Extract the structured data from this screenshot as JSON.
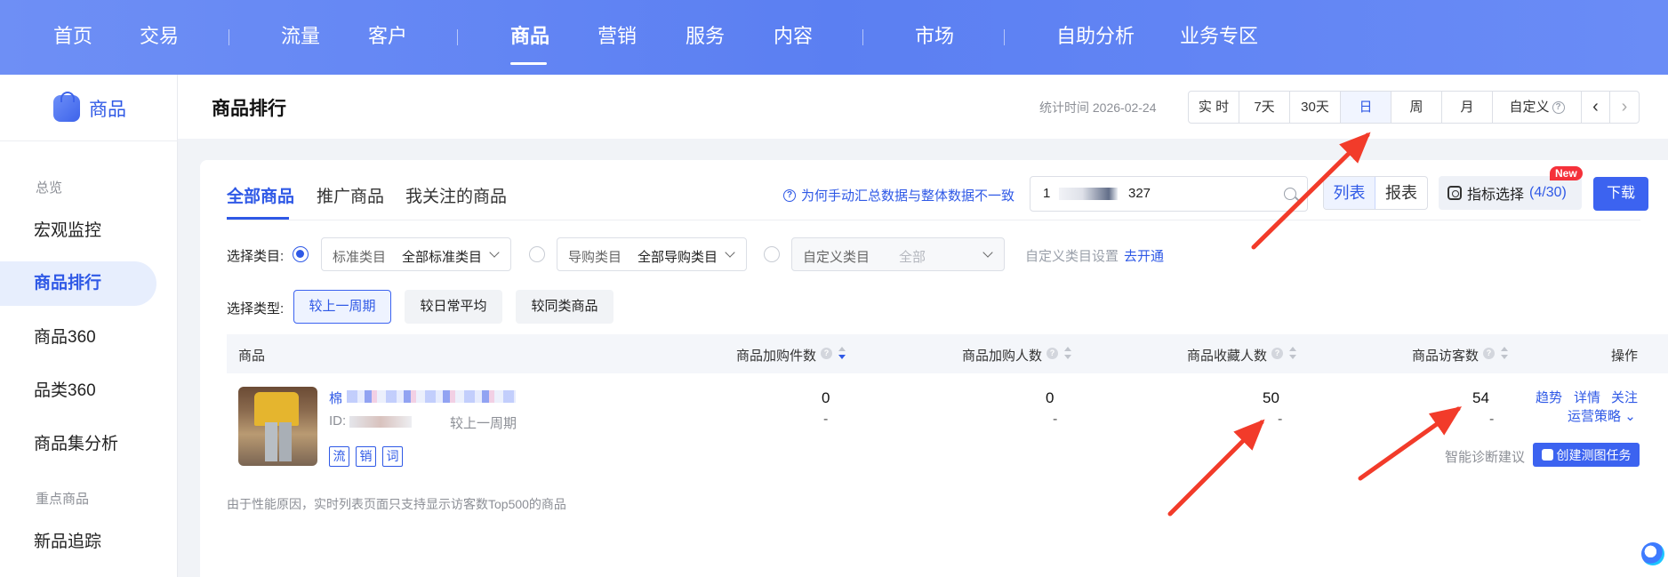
{
  "topnav": {
    "items": [
      "首页",
      "交易",
      "流量",
      "客户",
      "商品",
      "营销",
      "服务",
      "内容",
      "市场",
      "自助分析",
      "业务专区"
    ],
    "active": "商品"
  },
  "sidebar": {
    "brand": "商品",
    "groups": {
      "overview": "总览",
      "key": "重点商品"
    },
    "items": [
      "宏观监控",
      "商品排行",
      "商品360",
      "品类360",
      "商品集分析",
      "新品追踪"
    ],
    "active": "商品排行"
  },
  "header": {
    "title": "商品排行",
    "stat_time": "统计时间 2026-02-24",
    "periods": [
      "实 时",
      "7天",
      "30天",
      "日",
      "周",
      "月",
      "自定义"
    ],
    "active_period": "日"
  },
  "tabs": {
    "items": [
      "全部商品",
      "推广商品",
      "我关注的商品"
    ],
    "active": "全部商品",
    "help_link": "为何手动汇总数据与整体数据不一致",
    "search_value_start": "1",
    "search_value_end": "327",
    "view_list": "列表",
    "view_report": "报表",
    "metric_select": "指标选择",
    "metric_count": "(4/30)",
    "new_badge": "New",
    "download": "下载"
  },
  "filters": {
    "category_label": "选择类目:",
    "std_key": "标准类目",
    "std_value": "全部标准类目",
    "guide_key": "导购类目",
    "guide_value": "全部导购类目",
    "custom_key": "自定义类目",
    "custom_value": "全部",
    "custom_setting": "自定义类目设置",
    "enable_link": "去开通",
    "type_label": "选择类型:",
    "types": [
      "较上一周期",
      "较日常平均",
      "较同类商品"
    ],
    "active_type": "较上一周期"
  },
  "table": {
    "columns": [
      "商品",
      "商品加购件数",
      "商品加购人数",
      "商品收藏人数",
      "商品访客数",
      "操作"
    ],
    "rows": [
      {
        "name_prefix": "棉",
        "id_label": "ID:",
        "compare": "较上一周期",
        "tags": [
          "流",
          "销",
          "词"
        ],
        "cart_items": "0",
        "cart_items_change": "-",
        "cart_users": "0",
        "cart_users_change": "-",
        "fav_users": "50",
        "fav_users_change": "-",
        "visitors": "54",
        "visitors_change": "-",
        "ops": [
          "趋势",
          "详情",
          "关注"
        ],
        "strategy": "运营策略",
        "diagnosis": "智能诊断建议",
        "create_task": "创建测图任务"
      }
    ]
  },
  "footnote": "由于性能原因，实时列表页面只支持显示访客数Top500的商品",
  "colors": {
    "accent": "#2f59e6",
    "nav_bg": "#5b7ff2",
    "arrow": "#f23b2a"
  }
}
